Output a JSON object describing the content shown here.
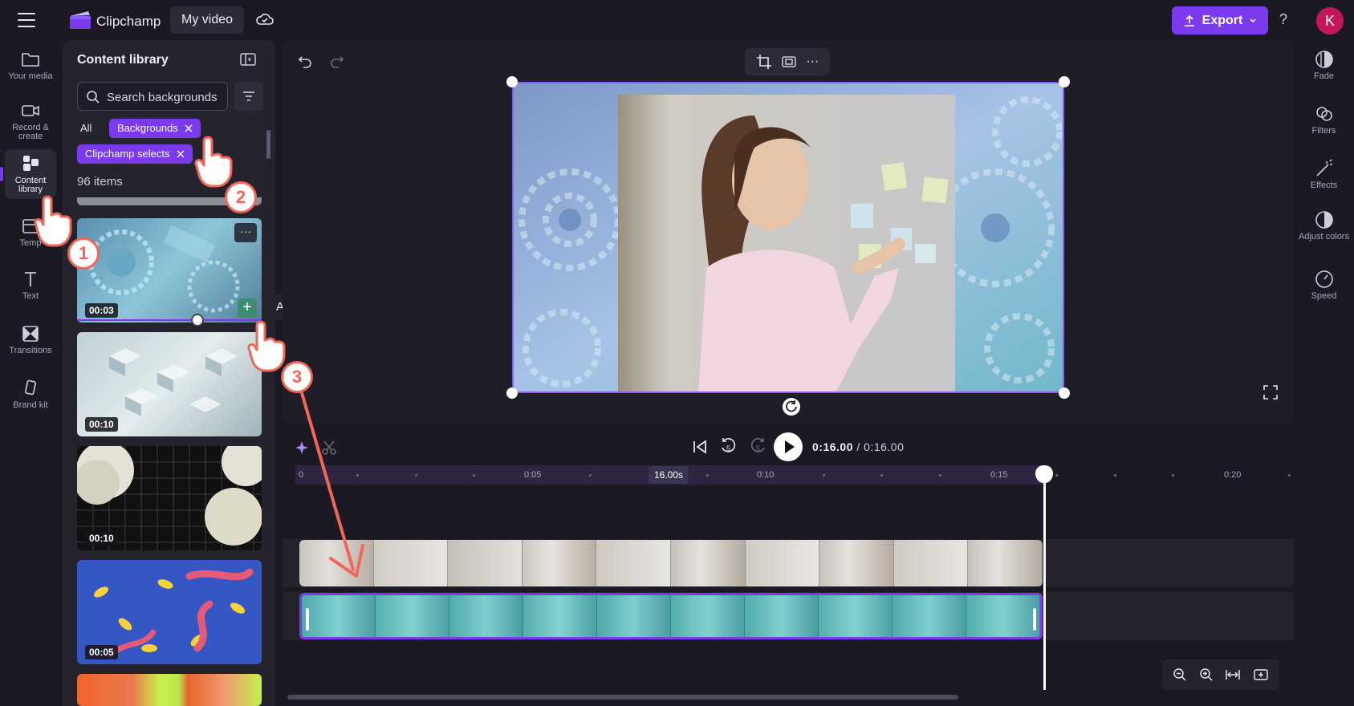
{
  "topbar": {
    "app_name": "Clipchamp",
    "project_name": "My video",
    "export_label": "Export",
    "help_label": "?",
    "avatar_letter": "K"
  },
  "left_rail": {
    "items": [
      {
        "label": "Your media"
      },
      {
        "label": "Record & create"
      },
      {
        "label": "Content library"
      },
      {
        "label": "Temp"
      },
      {
        "label": "Text"
      },
      {
        "label": "Transitions"
      },
      {
        "label": "Brand kit"
      }
    ]
  },
  "library": {
    "title": "Content library",
    "search_placeholder": "Search backgrounds",
    "chip_all": "All",
    "chip_backgrounds": "Backgrounds",
    "chip_selects": "Clipchamp selects",
    "items_count": "96 items",
    "thumbs": [
      {
        "duration": "00:03"
      },
      {
        "duration": "00:10"
      },
      {
        "duration": "00:10"
      },
      {
        "duration": "00:05"
      }
    ],
    "more_label": "···",
    "add_label": "+",
    "tooltip": "Add to timeline"
  },
  "right_rail": {
    "items": [
      {
        "label": "Fade"
      },
      {
        "label": "Filters"
      },
      {
        "label": "Effects"
      },
      {
        "label": "Adjust colors"
      },
      {
        "label": "Speed"
      }
    ]
  },
  "timeline": {
    "current_time": "0:16.00",
    "total_time": "/ 0:16.00",
    "duration_badge": "16.00s",
    "rewind_label": "5",
    "forward_label": "5",
    "ruler_labels": [
      "0",
      "0:05",
      "0:10",
      "0:15",
      "0:20"
    ]
  },
  "callouts": [
    "1",
    "2",
    "3"
  ],
  "colors": {
    "accent": "#7c3aed",
    "callout": "#f2665a",
    "background": "#1b1a24"
  }
}
